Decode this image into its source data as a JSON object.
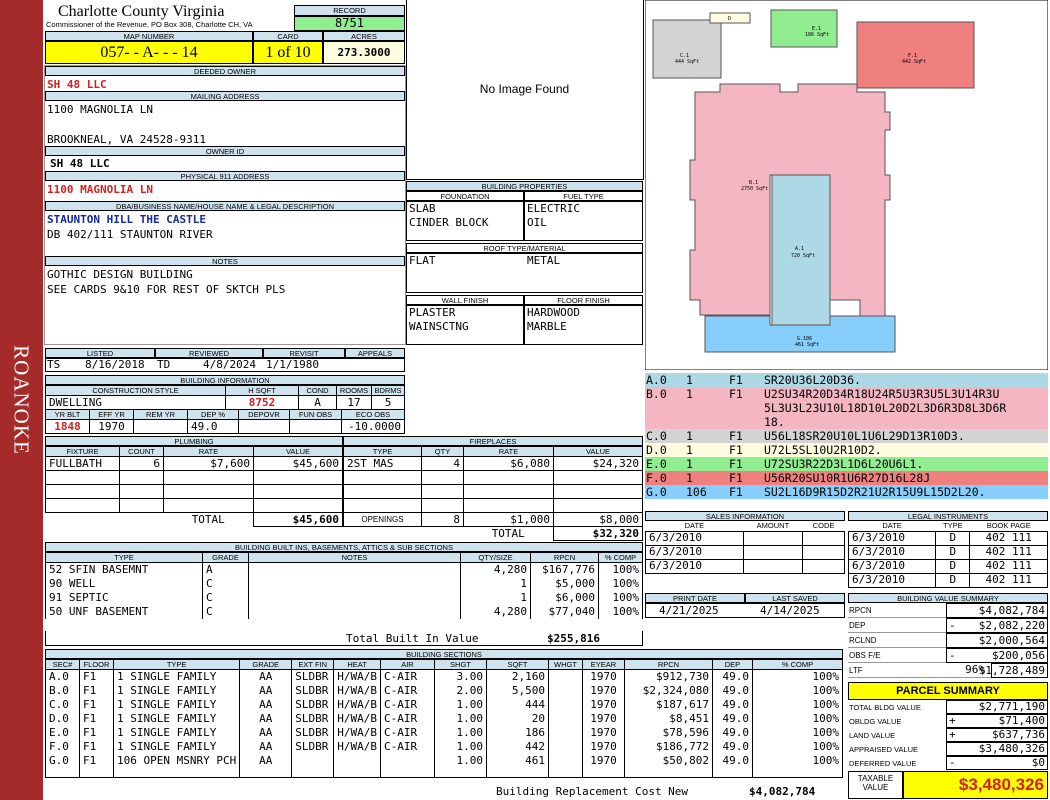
{
  "sidebar": {
    "label": "ROANOKE"
  },
  "header": {
    "county": "Charlotte County Virginia",
    "commissioner": "Commissioner of the Revenue, PO Box 308, Charlotte CH, VA",
    "record_label": "RECORD",
    "record": "8751",
    "map_number_label": "MAP NUMBER",
    "map_number": "057- - A- - - 14",
    "card_label": "CARD",
    "card": "1 of 10",
    "acres_label": "ACRES",
    "acres": "273.3000"
  },
  "owner": {
    "deeded_owner_label": "DEEDED OWNER",
    "deeded_owner": "SH 48 LLC",
    "mailing_label": "MAILING ADDRESS",
    "mailing_line1": "1100 MAGNOLIA LN",
    "mailing_line2": "",
    "mailing_line3": "BROOKNEAL, VA 24528-9311",
    "owner_id_label": "OWNER ID",
    "owner_id": "SH 48 LLC",
    "physical_label": "PHYSICAL 911 ADDRESS",
    "physical": "1100 MAGNOLIA LN",
    "dba_label": "DBA/BUSINESS NAME/HOUSE NAME & LEGAL DESCRIPTION",
    "dba": "STAUNTON HILL THE CASTLE",
    "legal": "DB 402/111 STAUNTON RIVER",
    "notes_label": "NOTES",
    "notes1": "GOTHIC DESIGN BUILDING",
    "notes2": "SEE CARDS 9&10 FOR REST OF SKTCH PLS"
  },
  "image": {
    "text": "No Image Found"
  },
  "props": {
    "title": "BUILDING PROPERTIES",
    "foundation_label": "FOUNDATION",
    "fuel_label": "FUEL TYPE",
    "foundation1": "SLAB",
    "foundation2": "CINDER BLOCK",
    "fuel1": "ELECTRIC",
    "fuel2": "OIL",
    "roof_label": "ROOF TYPE/MATERIAL",
    "roof1": "FLAT",
    "roof2": "METAL",
    "wall_label": "WALL FINISH",
    "floor_label": "FLOOR FINISH",
    "wall1": "PLASTER",
    "wall2": "WAINSCTNG",
    "floor1": "HARDWOOD",
    "floor2": "MARBLE"
  },
  "dates": {
    "listed_label": "LISTED",
    "reviewed_label": "REVIEWED",
    "revisit_label": "REVISIT",
    "appeals_label": "APPEALS",
    "listed_by": "TS",
    "listed": "8/16/2018",
    "reviewed_by": "TD",
    "reviewed": "4/8/2024",
    "revisit": "1/1/1980",
    "appeals": ""
  },
  "bldg_info": {
    "title": "BUILDING INFORMATION",
    "style_label": "CONSTRUCTION STYLE",
    "hsqft_label": "H SQFT",
    "cond_label": "COND",
    "rooms_label": "ROOMS",
    "bdrms_label": "BDRMS",
    "style": "DWELLING",
    "hsqft": "8752",
    "cond": "A",
    "rooms": "17",
    "bdrms": "5",
    "yrblt_label": "YR BLT",
    "effyr_label": "EFF YR",
    "remyr_label": "REM YR",
    "dep_label": "DEP %",
    "depovr_label": "DEPOVR",
    "funobs_label": "FUN OBS",
    "ecoobs_label": "ECO OBS",
    "yrblt": "1848",
    "effyr": "1970",
    "remyr": "",
    "dep": "49.0",
    "depovr": "",
    "funobs": "",
    "ecoobs": "-10.0000"
  },
  "plumbing": {
    "title": "PLUMBING",
    "cols": [
      "FIXTURE",
      "COUNT",
      "RATE",
      "VALUE"
    ],
    "rows": [
      [
        "FULLBATH",
        "6",
        "$7,600",
        "$45,600"
      ]
    ],
    "total_label": "TOTAL",
    "total": "$45,600"
  },
  "fireplaces": {
    "title": "FIREPLACES",
    "cols": [
      "TYPE",
      "QTY",
      "RATE",
      "VALUE"
    ],
    "rows": [
      [
        "2ST MAS",
        "4",
        "$6,080",
        "$24,320"
      ]
    ],
    "openings_label": "OPENINGS",
    "openings_qty": "8",
    "openings_rate": "$1,000",
    "openings_value": "$8,000",
    "total_label": "TOTAL",
    "total": "$32,320"
  },
  "builtins": {
    "title": "BUILDING BUILT INS, BASEMENTS, ATTICS & SUB SECTIONS",
    "cols": [
      "TYPE",
      "GRADE",
      "NOTES",
      "QTY/SIZE",
      "RPCN",
      "% COMP"
    ],
    "rows": [
      [
        "52 SFIN BASEMNT",
        "A",
        "",
        "4,280",
        "$167,776",
        "100%"
      ],
      [
        "90 WELL",
        "C",
        "",
        "1",
        "$5,000",
        "100%"
      ],
      [
        "91 SEPTIC",
        "C",
        "",
        "1",
        "$6,000",
        "100%"
      ],
      [
        "50 UNF BASEMENT",
        "C",
        "",
        "4,280",
        "$77,040",
        "100%"
      ]
    ],
    "total_label": "Total Built In Value",
    "total": "$255,816"
  },
  "sections": {
    "title": "BUILDING SECTIONS",
    "cols": [
      "SEC#",
      "FLOOR",
      "TYPE",
      "GRADE",
      "EXT FIN",
      "HEAT",
      "AIR",
      "SHGT",
      "SQFT",
      "WHGT",
      "EYEAR",
      "RPCN",
      "DEP",
      "% COMP"
    ],
    "rows": [
      [
        "A.0",
        "F1",
        "1 SINGLE FAMILY",
        "AA",
        "SLDBR",
        "H/WA/B",
        "C-AIR",
        "3.00",
        "2,160",
        "",
        "1970",
        "$912,730",
        "49.0",
        "100%"
      ],
      [
        "B.0",
        "F1",
        "1 SINGLE FAMILY",
        "AA",
        "SLDBR",
        "H/WA/B",
        "C-AIR",
        "2.00",
        "5,500",
        "",
        "1970",
        "$2,324,080",
        "49.0",
        "100%"
      ],
      [
        "C.0",
        "F1",
        "1 SINGLE FAMILY",
        "AA",
        "SLDBR",
        "H/WA/B",
        "C-AIR",
        "1.00",
        "444",
        "",
        "1970",
        "$187,617",
        "49.0",
        "100%"
      ],
      [
        "D.0",
        "F1",
        "1 SINGLE FAMILY",
        "AA",
        "SLDBR",
        "H/WA/B",
        "C-AIR",
        "1.00",
        "20",
        "",
        "1970",
        "$8,451",
        "49.0",
        "100%"
      ],
      [
        "E.0",
        "F1",
        "1 SINGLE FAMILY",
        "AA",
        "SLDBR",
        "H/WA/B",
        "C-AIR",
        "1.00",
        "186",
        "",
        "1970",
        "$78,596",
        "49.0",
        "100%"
      ],
      [
        "F.0",
        "F1",
        "1 SINGLE FAMILY",
        "AA",
        "SLDBR",
        "H/WA/B",
        "C-AIR",
        "1.00",
        "442",
        "",
        "1970",
        "$186,772",
        "49.0",
        "100%"
      ],
      [
        "G.0",
        "F1",
        "106 OPEN MSNRY PCH",
        "AA",
        "",
        "",
        "",
        "1.00",
        "461",
        "",
        "1970",
        "$50,802",
        "49.0",
        "100%"
      ]
    ],
    "replacement_label": "Building Replacement Cost New",
    "replacement": "$4,082,784"
  },
  "sketch_codes": [
    {
      "sec": "A.0",
      "n": "1",
      "f": "F1",
      "code": "SR20U36L20D36.",
      "color": "#add8e6"
    },
    {
      "sec": "B.0",
      "n": "1",
      "f": "F1",
      "code": "U2SU34R20D34R18U24R5U3R3U5L3U14R3U",
      "code2": "5L3U3L23U10L18D10L20D2L3D6R3D8L3D6R",
      "code3": "18.",
      "color": "#f4b6c2"
    },
    {
      "sec": "C.0",
      "n": "1",
      "f": "F1",
      "code": "U56L18SR20U10L1U6L29D13R10D3.",
      "color": "#d3d3d3"
    },
    {
      "sec": "D.0",
      "n": "1",
      "f": "F1",
      "code": "U72L5SL10U2R10D2.",
      "color": "#fffde0"
    },
    {
      "sec": "E.0",
      "n": "1",
      "f": "F1",
      "code": "U72SU3R22D3L1D6L20U6L1.",
      "color": "#90ee90"
    },
    {
      "sec": "F.0",
      "n": "1",
      "f": "F1",
      "code": "U56R20SU10R1U6R27D16L28J",
      "color": "#f08080"
    },
    {
      "sec": "G.0",
      "n": "106",
      "f": "F1",
      "code": "SU2L16D9R15D2R21U2R15U9L15D2L20.",
      "color": "#87cefa"
    }
  ],
  "sketch_labels": {
    "a": "A.1",
    "a_sqft": "720 SqFt",
    "b": "B.1",
    "b_sqft": "2750 SqFt",
    "c": "C.1",
    "c_sqft": "444 SqFt",
    "d": "D",
    "e": "E.1",
    "e_sqft": "186 SqFt",
    "f": "F.1",
    "f_sqft": "442 SqFt",
    "g": "G.106",
    "g_sqft": "461 SqFt"
  },
  "sales": {
    "title": "SALES INFORMATION",
    "cols": [
      "DATE",
      "AMOUNT",
      "CODE"
    ],
    "rows": [
      [
        "6/3/2010",
        "",
        ""
      ],
      [
        "6/3/2010",
        "",
        ""
      ],
      [
        "6/3/2010",
        "",
        ""
      ]
    ]
  },
  "legal": {
    "title": "LEGAL INSTRUMENTS",
    "cols": [
      "DATE",
      "TYPE",
      "BOOK PAGE"
    ],
    "rows": [
      [
        "6/3/2010",
        "D",
        "402 111"
      ],
      [
        "6/3/2010",
        "D",
        "402 111"
      ],
      [
        "6/3/2010",
        "D",
        "402 111"
      ],
      [
        "6/3/2010",
        "D",
        "402 111"
      ]
    ]
  },
  "print": {
    "print_label": "PRINT DATE",
    "saved_label": "LAST SAVED",
    "print_date": "4/21/2025",
    "last_saved": "4/14/2025"
  },
  "value_summary": {
    "title": "BUILDING VALUE SUMMARY",
    "rows": [
      {
        "label": "RPCN",
        "sign": "",
        "pct": "",
        "value": "$4,082,784"
      },
      {
        "label": "DEP",
        "sign": "-",
        "pct": "",
        "value": "$2,082,220"
      },
      {
        "label": "RCLND",
        "sign": "",
        "pct": "",
        "value": "$2,000,564"
      },
      {
        "label": "OBS F/E",
        "sign": "-",
        "pct": "",
        "value": "$200,056"
      },
      {
        "label": "LTF",
        "sign": "",
        "pct": "96%",
        "value": "$1,728,489"
      }
    ]
  },
  "parcel": {
    "title": "PARCEL SUMMARY",
    "rows": [
      {
        "label": "TOTAL BLDG VALUE",
        "sign": "",
        "value": "$2,771,190"
      },
      {
        "label": "OBLDG VALUE",
        "sign": "+",
        "value": "$71,400"
      },
      {
        "label": "LAND VALUE",
        "sign": "+",
        "value": "$637,736"
      },
      {
        "label": "APPRAISED VALUE",
        "sign": "",
        "value": "$3,480,326"
      },
      {
        "label": "DEFERRED VALUE",
        "sign": "-",
        "value": "$0"
      }
    ],
    "taxable_label1": "TAXABLE",
    "taxable_label2": "VALUE",
    "taxable": "$3,480,326"
  }
}
